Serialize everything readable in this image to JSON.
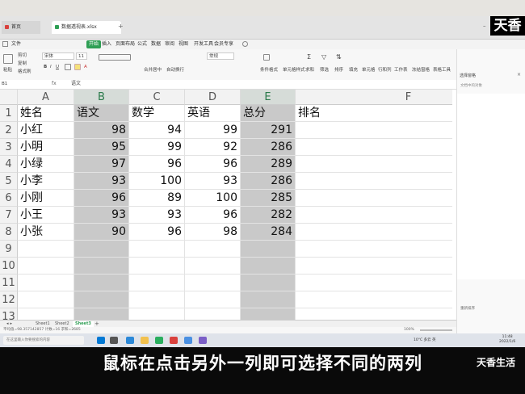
{
  "overlay": {
    "logo_top": "天香",
    "caption": "鼠标在点击另外一列即可选择不同的两列",
    "brand_bottom": "天香生活"
  },
  "window": {
    "tab_home": "首页",
    "tab_file": "数据透视表.xlsx"
  },
  "menu": {
    "file": "文件",
    "start": "开始",
    "insert": "插入",
    "layout": "页面布局",
    "formula": "公式",
    "data": "数据",
    "review": "审阅",
    "view": "视图",
    "dev": "开发工具",
    "member": "会员专享"
  },
  "toolbar": {
    "paste": "粘贴",
    "cut": "剪切",
    "copy": "复制",
    "format_painter": "格式刷",
    "font_name": "宋体",
    "font_size": "11",
    "merge_center": "合并居中",
    "auto_wrap": "自动换行",
    "number_format": "常规",
    "cond_format": "条件格式",
    "cell_style": "单元格样式",
    "sum": "求和",
    "filter": "筛选",
    "sort": "排序",
    "fill": "填充",
    "cell": "单元格",
    "row_col": "行和列",
    "worksheet": "工作表",
    "freeze": "冻结窗格",
    "table_tools": "表格工具",
    "find": "查找",
    "symbol": "符号"
  },
  "formula_bar": {
    "name_box": "B1",
    "fx": "fx",
    "content": "语文"
  },
  "grid": {
    "columns": [
      "A",
      "B",
      "C",
      "D",
      "E",
      "F"
    ],
    "selected_columns": [
      "B",
      "E"
    ],
    "rows": [
      "1",
      "2",
      "3",
      "4",
      "5",
      "6",
      "7",
      "8",
      "9",
      "10",
      "11",
      "12",
      "13",
      "14",
      "15"
    ],
    "header": [
      "姓名",
      "语文",
      "数学",
      "英语",
      "总分",
      "排名"
    ],
    "data": [
      [
        "小红",
        "98",
        "94",
        "99",
        "291"
      ],
      [
        "小明",
        "95",
        "99",
        "92",
        "286"
      ],
      [
        "小绿",
        "97",
        "96",
        "96",
        "289"
      ],
      [
        "小李",
        "93",
        "100",
        "93",
        "286"
      ],
      [
        "小刚",
        "96",
        "89",
        "100",
        "285"
      ],
      [
        "小王",
        "93",
        "93",
        "96",
        "282"
      ],
      [
        "小张",
        "90",
        "96",
        "98",
        "284"
      ]
    ]
  },
  "sheets": [
    "Sheet1",
    "Sheet2",
    "Sheet3"
  ],
  "status": {
    "text": "平均值=98.357142857 计数=16 求和=2685",
    "zoom": "100%"
  },
  "right_panel": {
    "title": "选择窗格",
    "subtitle": "文档中的对象",
    "bottom": "重新排序"
  },
  "taskbar": {
    "search_placeholder": "在这里输入你要搜索的内容",
    "weather": "10°C 多云",
    "lang": "英",
    "time": "11:48",
    "date": "2022/1/6"
  },
  "colors": {
    "accent": "#2f9f55",
    "selected_column": "#c9c9c9"
  }
}
